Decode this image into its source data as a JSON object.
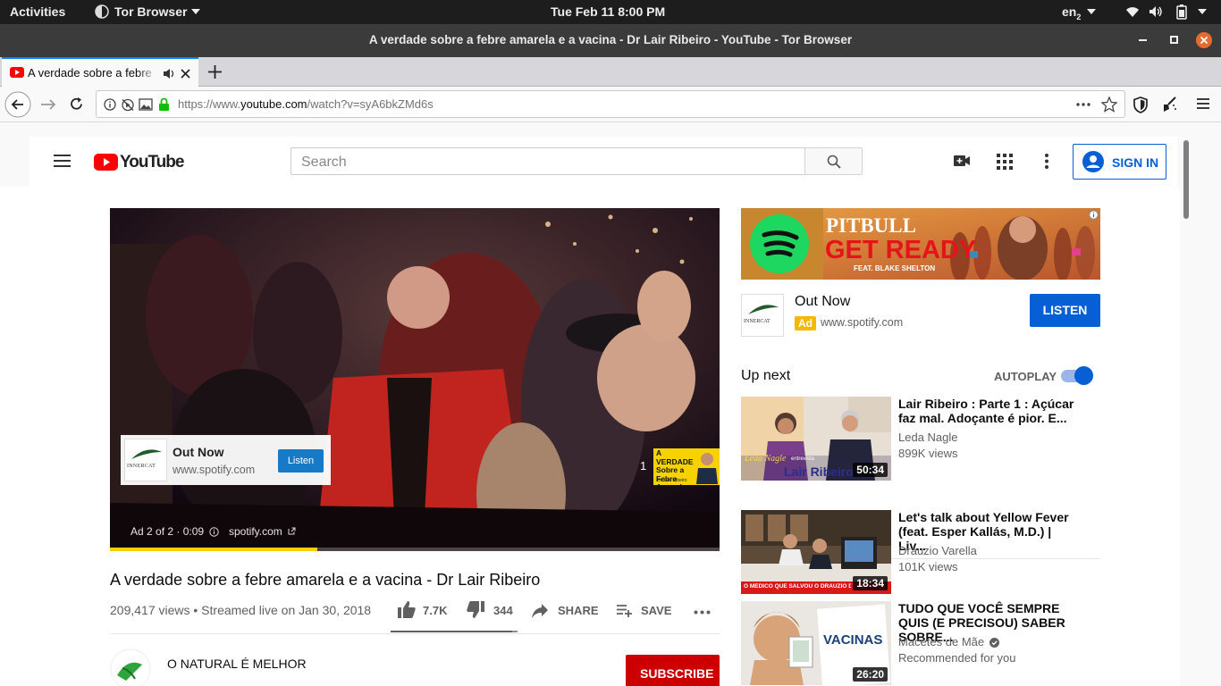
{
  "system_bar": {
    "activities": "Activities",
    "app_menu": "Tor Browser",
    "clock": "Tue Feb 11   8:00 PM",
    "keyboard_layout": "en",
    "keyboard_layout_sub": "2"
  },
  "window": {
    "title": "A verdade sobre a febre amarela e a vacina - Dr Lair Ribeiro - YouTube - Tor Browser"
  },
  "tabs": [
    {
      "label": "A verdade sobre a febre amarela e a vacina - Dr Lair Ribeiro - YouTube",
      "active": true
    }
  ],
  "urlbar": {
    "url_prefix": "https://www.",
    "url_host": "youtube.com",
    "url_path": "/watch?v=syA6bkZMd6s"
  },
  "youtube": {
    "logo_text": "YouTube",
    "search_placeholder": "Search",
    "sign_in": "SIGN IN",
    "player": {
      "ad_card_title": "Out Now",
      "ad_card_url": "www.spotify.com",
      "ad_card_button": "Listen",
      "ad_logo_text": "INNERCAT",
      "ad_status": "Ad 2 of 2 · 0:09",
      "ad_domain": "spotify.com",
      "queue_number": "1",
      "queue_thumb_text": "A VERDADE Sobre a Febre Amarela",
      "queue_thumb_caption": "Dr. Lair Ribeiro",
      "ad_progress": 0.34
    },
    "video": {
      "title": "A verdade sobre a febre amarela e a vacina - Dr Lair Ribeiro",
      "meta": "209,417 views • Streamed live on Jan 30, 2018",
      "likes": "7.7K",
      "dislikes": "344",
      "share": "SHARE",
      "save": "SAVE",
      "like_ratio": 0.96
    },
    "channel": {
      "name": "O NATURAL É MELHOR",
      "subscribe": "SUBSCRIBE"
    },
    "sidebar_ad": {
      "banner_artist": "PITBULL",
      "banner_song": "GET READY",
      "banner_feat": "FEAT. BLAKE SHELTON",
      "title": "Out Now",
      "badge": "Ad",
      "url": "www.spotify.com",
      "button": "LISTEN"
    },
    "up_next": {
      "heading": "Up next",
      "autoplay_label": "AUTOPLAY",
      "autoplay_on": true,
      "videos": [
        {
          "title": "Lair Ribeiro : Parte 1 : Açúcar faz mal. Adoçante é pior. E...",
          "channel": "Leda Nagle",
          "views": "899K views",
          "duration": "50:34",
          "thumb_caption_top": "Leda Nagle",
          "thumb_caption_sub": "entrevista",
          "thumb_caption": "Lair Ribeiro"
        },
        {
          "title": "Let's talk about Yellow Fever (feat. Esper Kallás, M.D.) | Liv...",
          "channel": "Drauzio Varella",
          "views": "101K views",
          "duration": "18:34",
          "thumb_caption": "O MÉDICO QUE SALVOU O DRAUZIO DA FEBRE"
        },
        {
          "title": "TUDO QUE VOCÊ SEMPRE QUIS (E PRECISOU) SABER SOBRE...",
          "channel": "Macetes de Mãe",
          "views": "Recommended for you",
          "duration": "26:20",
          "thumb_caption": "VACINAS",
          "verified": true
        }
      ]
    }
  },
  "colors": {
    "yt_red": "#ff0000",
    "blue": "#065fd4",
    "subscribe_red": "#cc0000",
    "ad_yellow": "#ffcc00",
    "spotify_green": "#1ed760"
  }
}
